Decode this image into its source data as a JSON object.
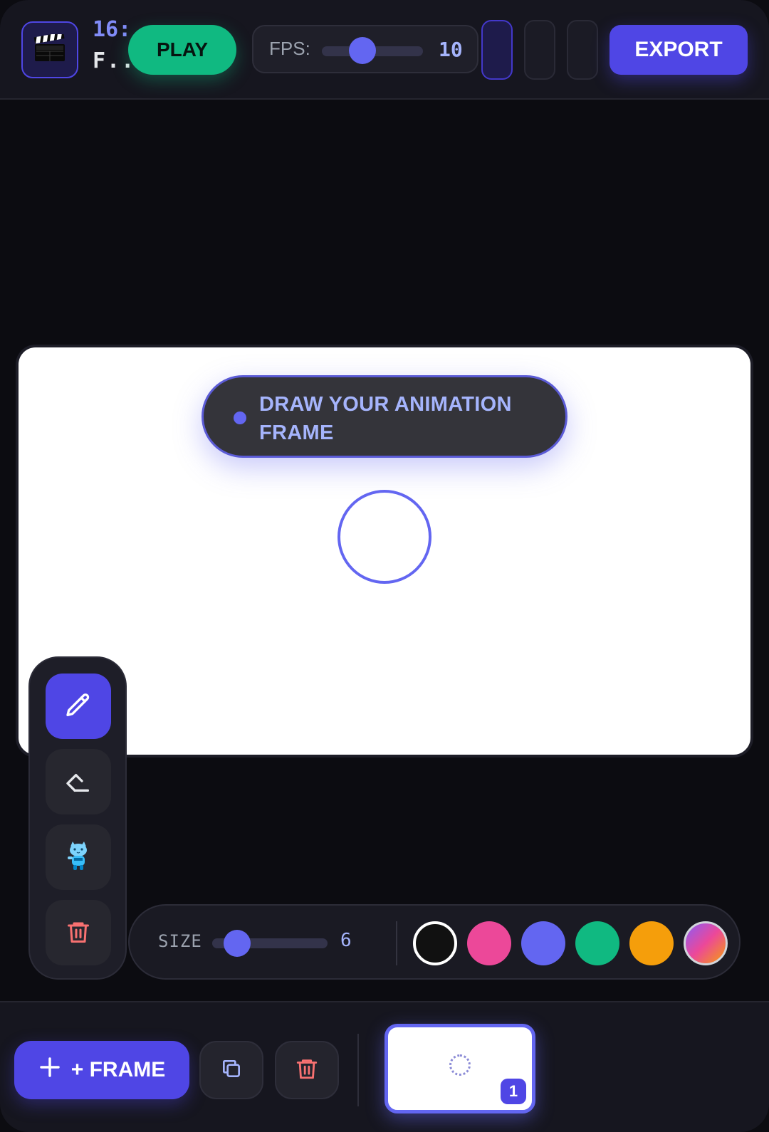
{
  "header": {
    "logo_icon": "clapperboard-icon",
    "time_label": "16:",
    "title_truncated": "F..",
    "play_label": "PLAY",
    "fps": {
      "label": "FPS:",
      "value": "10",
      "level": 0.4
    },
    "export_label": "EXPORT"
  },
  "canvas": {
    "hint_text": "DRAW YOUR ANIMATION FRAME"
  },
  "tools": [
    {
      "name": "pencil",
      "icon": "pencil-icon",
      "active": true
    },
    {
      "name": "eraser",
      "icon": "eraser-icon",
      "active": false
    },
    {
      "name": "sticker",
      "icon": "cat-sticker-icon",
      "active": false
    },
    {
      "name": "clear",
      "icon": "trash-icon",
      "active": false
    }
  ],
  "brush": {
    "size_label": "SIZE",
    "size_value": "6",
    "size_level": 0.2,
    "colors": [
      {
        "name": "black",
        "hex": "#111111",
        "selected": true
      },
      {
        "name": "pink",
        "hex": "#ec4899",
        "selected": false
      },
      {
        "name": "indigo",
        "hex": "#6366f1",
        "selected": false
      },
      {
        "name": "green",
        "hex": "#10b981",
        "selected": false
      },
      {
        "name": "orange",
        "hex": "#f59e0b",
        "selected": false
      },
      {
        "name": "gradient",
        "hex": "linear-gradient(135deg,#8b5cf6,#ec4899,#f59e0b)",
        "selected": false
      }
    ]
  },
  "footer": {
    "add_frame_label": "+ FRAME",
    "duplicate_icon": "duplicate-icon",
    "delete_icon": "trash-icon",
    "frames": [
      {
        "number": "1",
        "selected": true
      }
    ]
  },
  "colors": {
    "accent": "#4f46e5",
    "accent_light": "#6366f1",
    "play": "#10b981",
    "danger": "#f87171"
  }
}
